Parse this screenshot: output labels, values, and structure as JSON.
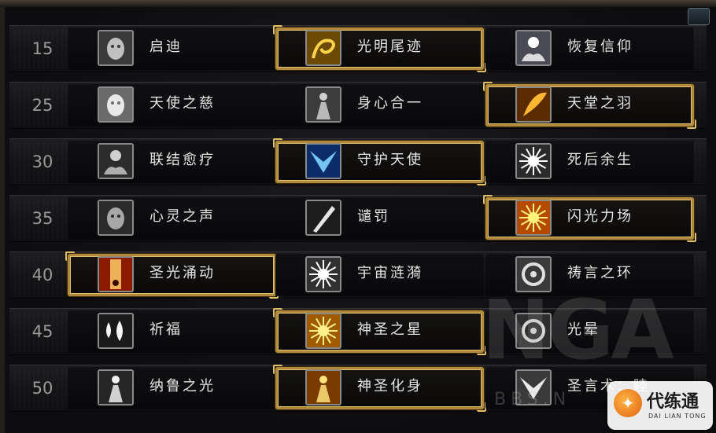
{
  "colors": {
    "selected_border": "#b08a3a",
    "text": "#e6e6e6",
    "level_text": "#9a9a9a"
  },
  "rows": [
    {
      "level": "15",
      "talents": [
        {
          "name": "启迪",
          "icon": "hand-face-icon",
          "selected": false
        },
        {
          "name": "光明尾迹",
          "icon": "golden-trail-icon",
          "selected": true
        },
        {
          "name": "恢复信仰",
          "icon": "glowing-hands-icon",
          "selected": false
        }
      ]
    },
    {
      "level": "25",
      "talents": [
        {
          "name": "天使之慈",
          "icon": "angel-face-icon",
          "selected": false
        },
        {
          "name": "身心合一",
          "icon": "robed-figure-icon",
          "selected": false
        },
        {
          "name": "天堂之羽",
          "icon": "golden-feather-icon",
          "selected": true
        }
      ]
    },
    {
      "level": "30",
      "talents": [
        {
          "name": "联结愈疗",
          "icon": "joined-hands-icon",
          "selected": false
        },
        {
          "name": "守护天使",
          "icon": "angel-wings-icon",
          "selected": true
        },
        {
          "name": "死后余生",
          "icon": "white-burst-icon",
          "selected": false
        }
      ]
    },
    {
      "level": "35",
      "talents": [
        {
          "name": "心灵之声",
          "icon": "screaming-face-icon",
          "selected": false
        },
        {
          "name": "谴罚",
          "icon": "sword-strike-icon",
          "selected": false
        },
        {
          "name": "闪光力场",
          "icon": "radiant-star-icon",
          "selected": true
        }
      ]
    },
    {
      "level": "40",
      "talents": [
        {
          "name": "圣光涌动",
          "icon": "light-pillar-icon",
          "selected": true
        },
        {
          "name": "宇宙涟漪",
          "icon": "cosmic-ripple-icon",
          "selected": false
        },
        {
          "name": "祷言之环",
          "icon": "halo-ring-icon",
          "selected": false
        }
      ]
    },
    {
      "level": "45",
      "talents": [
        {
          "name": "祈福",
          "icon": "blessing-drops-icon",
          "selected": false
        },
        {
          "name": "神圣之星",
          "icon": "divine-star-icon",
          "selected": true
        },
        {
          "name": "光晕",
          "icon": "halo-icon",
          "selected": false
        }
      ]
    },
    {
      "level": "50",
      "talents": [
        {
          "name": "纳鲁之光",
          "icon": "naaru-icon",
          "selected": false
        },
        {
          "name": "神圣化身",
          "icon": "holy-figure-icon",
          "selected": true
        },
        {
          "name": "圣言术：睦",
          "icon": "white-wings-icon",
          "selected": false
        }
      ]
    }
  ],
  "watermark": {
    "text": "NGA",
    "sub": "BBS.N"
  },
  "badge": {
    "title": "代练通",
    "subtitle": "DAI LIAN TONG"
  }
}
